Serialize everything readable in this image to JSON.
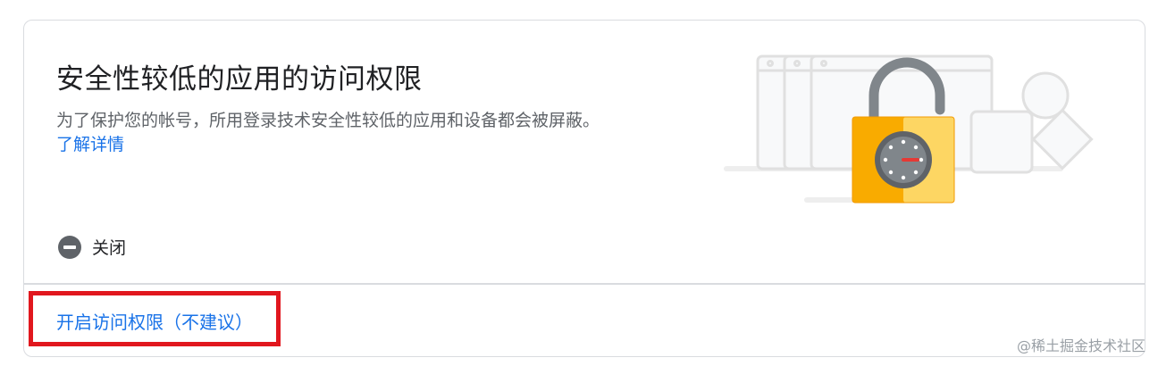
{
  "card": {
    "title": "安全性较低的应用的访问权限",
    "description": "为了保护您的帐号，所用登录技术安全性较低的应用和设备都会被屏蔽。",
    "learn_more": "了解详情",
    "status_label": "关闭",
    "enable_link": "开启访问权限（不建议）"
  },
  "watermark": "@稀土掘金技术社区",
  "colors": {
    "link": "#1a73e8",
    "title": "#202124",
    "secondary_text": "#5f6368",
    "highlight_box": "#e1171e",
    "lock_body": "#f9ab00"
  },
  "icons": {
    "status": "minus-circle-icon",
    "illustration": "padlock-illustration"
  }
}
